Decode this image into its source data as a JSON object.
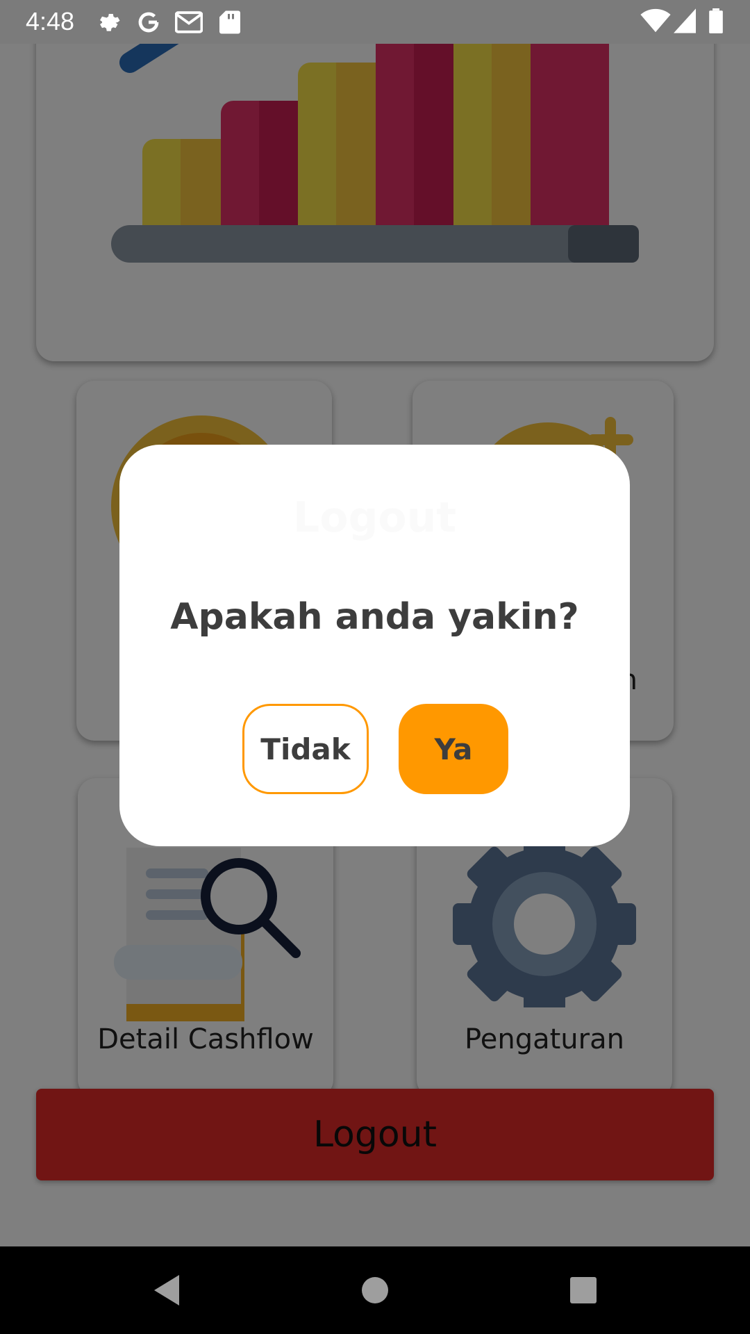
{
  "status_bar": {
    "time": "4:48",
    "icons": [
      "settings-icon",
      "google-icon",
      "gmail-icon",
      "sd-card-icon",
      "wifi-icon",
      "signal-icon",
      "battery-icon"
    ]
  },
  "cards": {
    "detail_cashflow": "Detail Cashflow",
    "settings": "Pengaturan",
    "partial_label": "n"
  },
  "logout_button": "Logout",
  "dialog": {
    "title": "Logout",
    "message": "Apakah anda yakin?",
    "cancel_label": "Tidak",
    "confirm_label": "Ya"
  },
  "nav_bar": {
    "icons": [
      "back-icon",
      "home-icon",
      "recents-icon"
    ]
  },
  "colors": {
    "accent": "#ff9800",
    "logout": "#e32b29",
    "dialog_bg": "#ffffff",
    "text": "#3d3d3d"
  }
}
